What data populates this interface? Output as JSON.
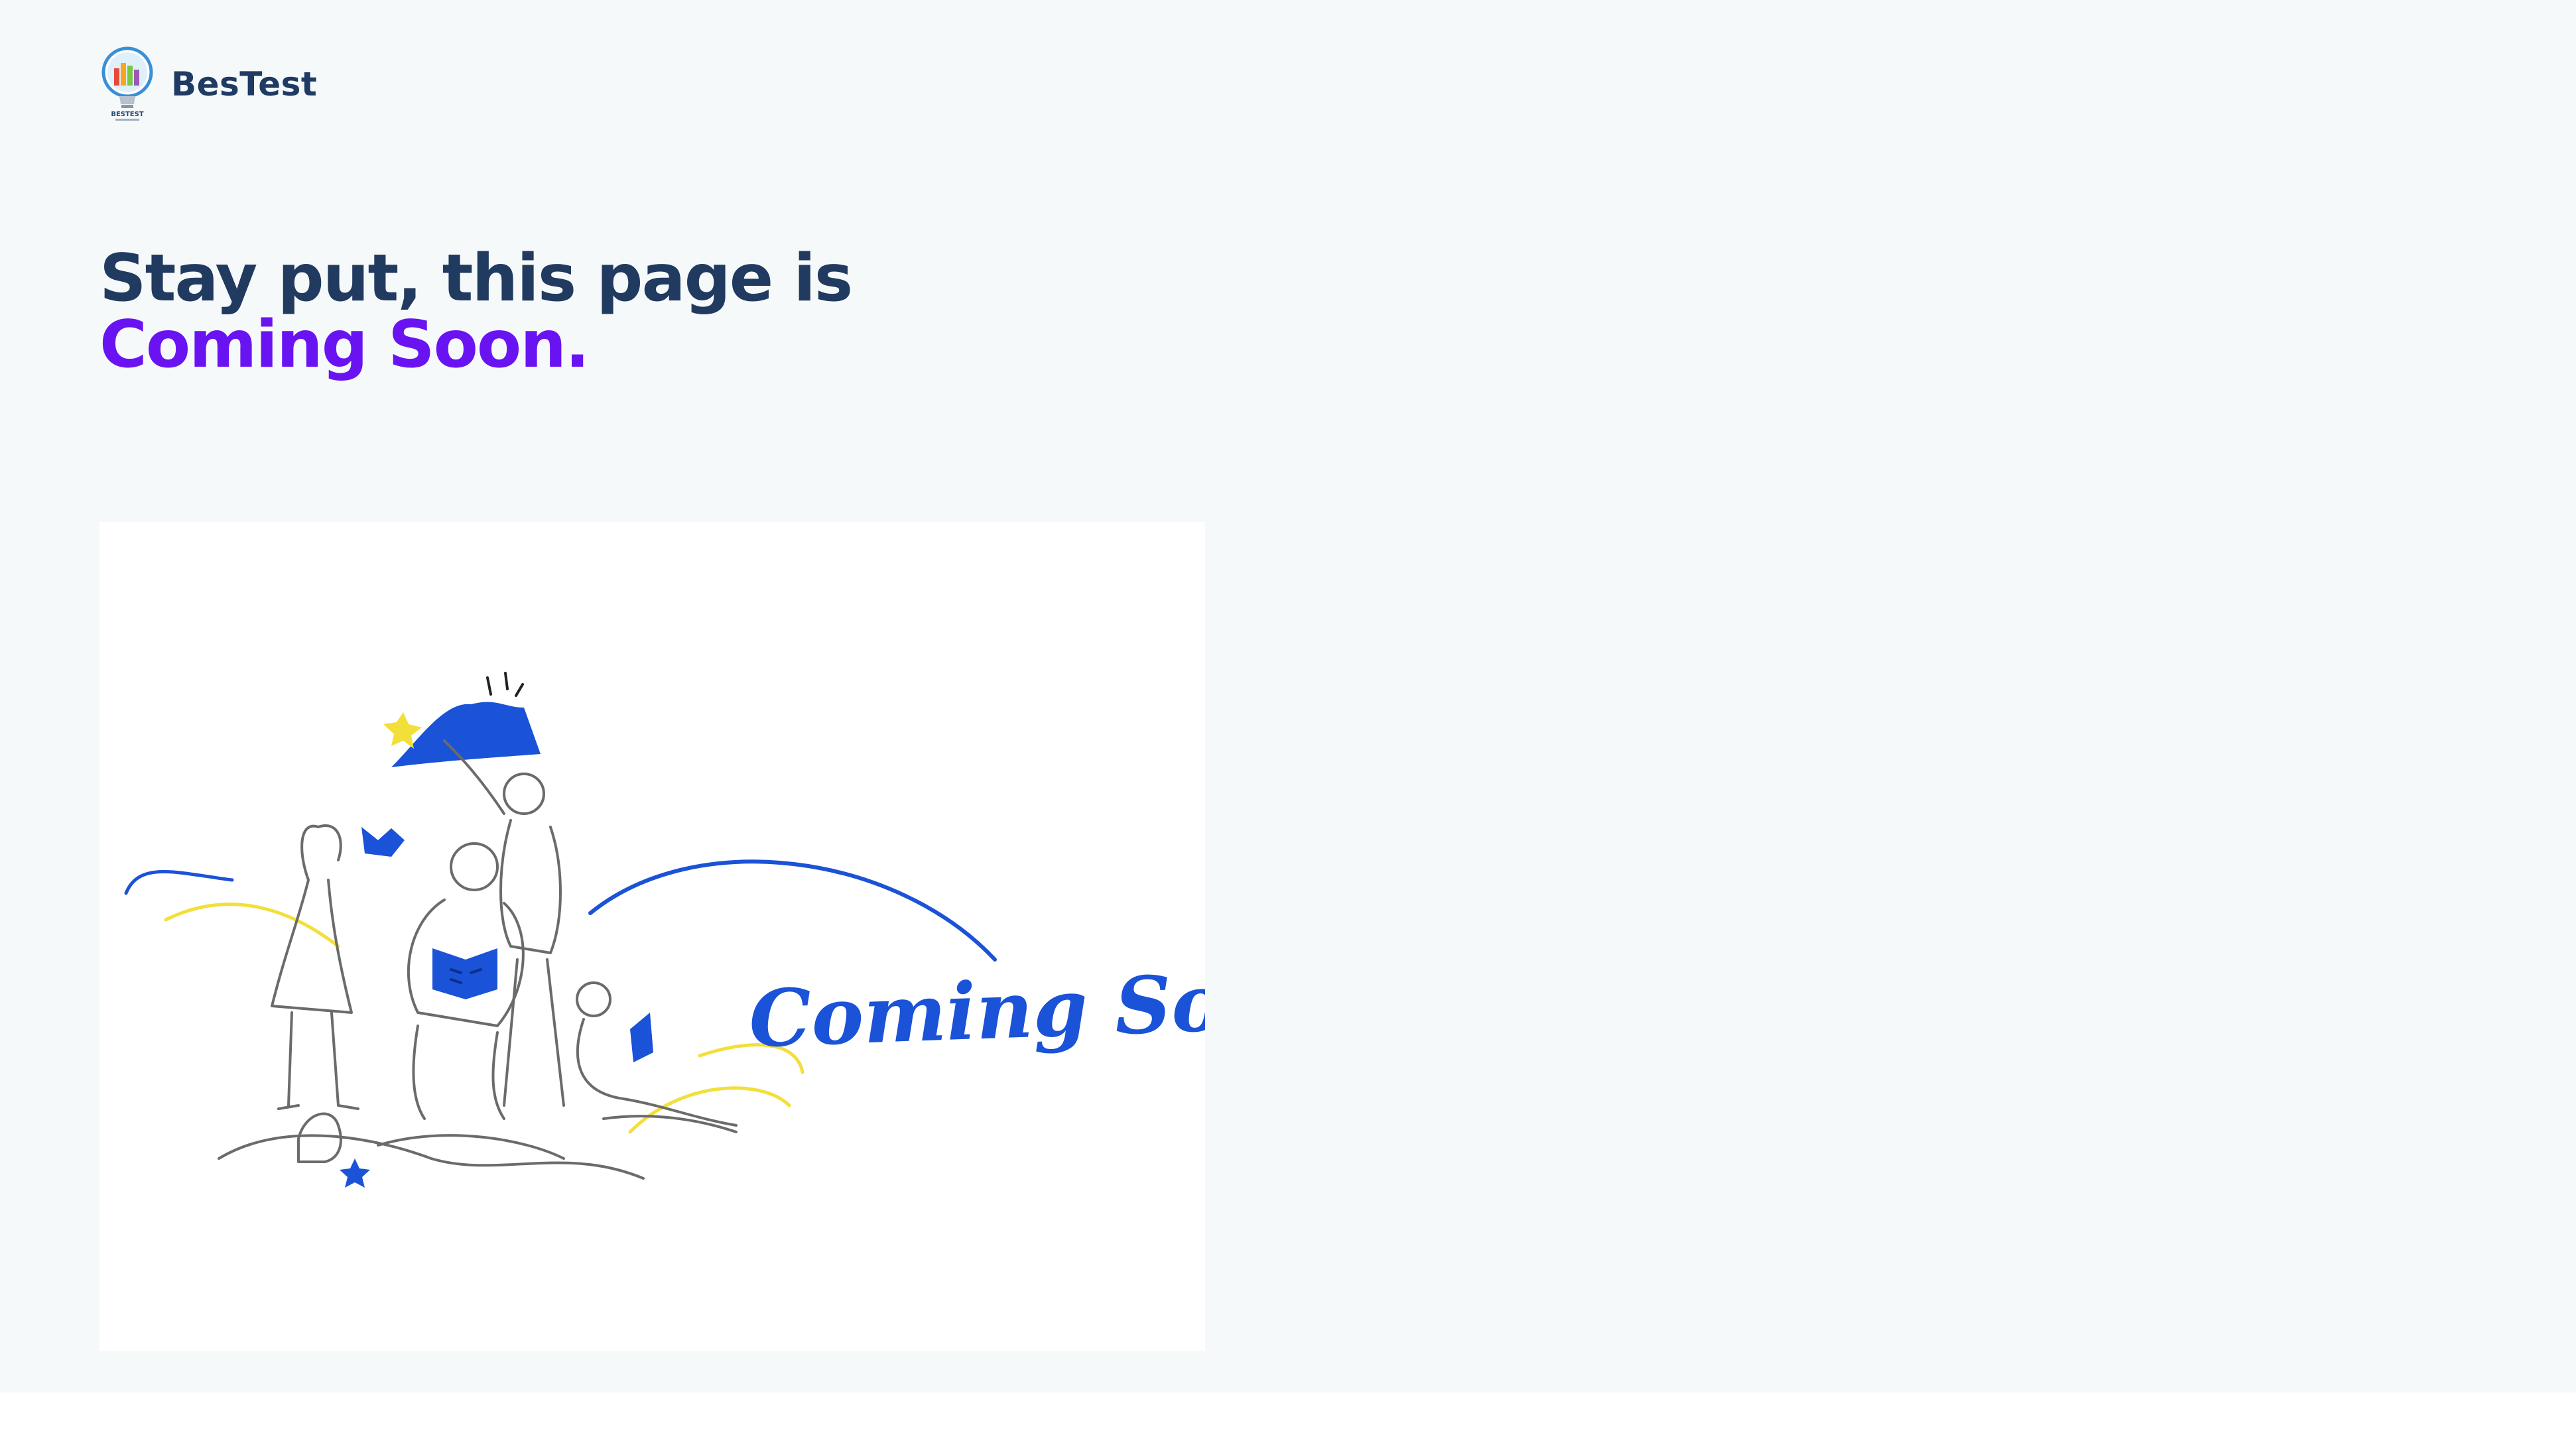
{
  "header": {
    "brand_name": "BesTest",
    "logo_icon": "bestest-lightbulb-logo",
    "logo_text": "BESTEST"
  },
  "hero": {
    "title_line1": "Stay put, this page is",
    "title_line2": "Coming Soon."
  },
  "illustration": {
    "caption": "Coming Soon!",
    "icon": "people-reading-illustration"
  },
  "colors": {
    "page_background": "#f6f9fa",
    "title_dark": "#213a5f",
    "title_accent": "#6a13f2",
    "illustration_blue": "#1a52d8",
    "illustration_yellow": "#f2df3a",
    "line_gray": "#6b6b6b"
  }
}
